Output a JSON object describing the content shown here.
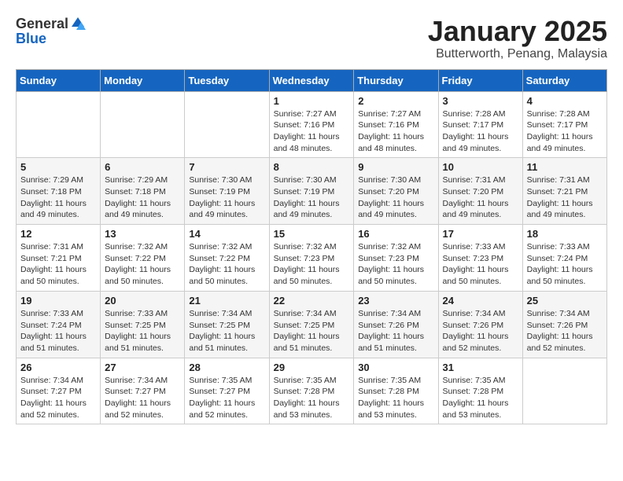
{
  "header": {
    "logo_general": "General",
    "logo_blue": "Blue",
    "month_title": "January 2025",
    "subtitle": "Butterworth, Penang, Malaysia"
  },
  "weekdays": [
    "Sunday",
    "Monday",
    "Tuesday",
    "Wednesday",
    "Thursday",
    "Friday",
    "Saturday"
  ],
  "weeks": [
    [
      {
        "day": "",
        "info": ""
      },
      {
        "day": "",
        "info": ""
      },
      {
        "day": "",
        "info": ""
      },
      {
        "day": "1",
        "info": "Sunrise: 7:27 AM\nSunset: 7:16 PM\nDaylight: 11 hours and 48 minutes."
      },
      {
        "day": "2",
        "info": "Sunrise: 7:27 AM\nSunset: 7:16 PM\nDaylight: 11 hours and 48 minutes."
      },
      {
        "day": "3",
        "info": "Sunrise: 7:28 AM\nSunset: 7:17 PM\nDaylight: 11 hours and 49 minutes."
      },
      {
        "day": "4",
        "info": "Sunrise: 7:28 AM\nSunset: 7:17 PM\nDaylight: 11 hours and 49 minutes."
      }
    ],
    [
      {
        "day": "5",
        "info": "Sunrise: 7:29 AM\nSunset: 7:18 PM\nDaylight: 11 hours and 49 minutes."
      },
      {
        "day": "6",
        "info": "Sunrise: 7:29 AM\nSunset: 7:18 PM\nDaylight: 11 hours and 49 minutes."
      },
      {
        "day": "7",
        "info": "Sunrise: 7:30 AM\nSunset: 7:19 PM\nDaylight: 11 hours and 49 minutes."
      },
      {
        "day": "8",
        "info": "Sunrise: 7:30 AM\nSunset: 7:19 PM\nDaylight: 11 hours and 49 minutes."
      },
      {
        "day": "9",
        "info": "Sunrise: 7:30 AM\nSunset: 7:20 PM\nDaylight: 11 hours and 49 minutes."
      },
      {
        "day": "10",
        "info": "Sunrise: 7:31 AM\nSunset: 7:20 PM\nDaylight: 11 hours and 49 minutes."
      },
      {
        "day": "11",
        "info": "Sunrise: 7:31 AM\nSunset: 7:21 PM\nDaylight: 11 hours and 49 minutes."
      }
    ],
    [
      {
        "day": "12",
        "info": "Sunrise: 7:31 AM\nSunset: 7:21 PM\nDaylight: 11 hours and 50 minutes."
      },
      {
        "day": "13",
        "info": "Sunrise: 7:32 AM\nSunset: 7:22 PM\nDaylight: 11 hours and 50 minutes."
      },
      {
        "day": "14",
        "info": "Sunrise: 7:32 AM\nSunset: 7:22 PM\nDaylight: 11 hours and 50 minutes."
      },
      {
        "day": "15",
        "info": "Sunrise: 7:32 AM\nSunset: 7:23 PM\nDaylight: 11 hours and 50 minutes."
      },
      {
        "day": "16",
        "info": "Sunrise: 7:32 AM\nSunset: 7:23 PM\nDaylight: 11 hours and 50 minutes."
      },
      {
        "day": "17",
        "info": "Sunrise: 7:33 AM\nSunset: 7:23 PM\nDaylight: 11 hours and 50 minutes."
      },
      {
        "day": "18",
        "info": "Sunrise: 7:33 AM\nSunset: 7:24 PM\nDaylight: 11 hours and 50 minutes."
      }
    ],
    [
      {
        "day": "19",
        "info": "Sunrise: 7:33 AM\nSunset: 7:24 PM\nDaylight: 11 hours and 51 minutes."
      },
      {
        "day": "20",
        "info": "Sunrise: 7:33 AM\nSunset: 7:25 PM\nDaylight: 11 hours and 51 minutes."
      },
      {
        "day": "21",
        "info": "Sunrise: 7:34 AM\nSunset: 7:25 PM\nDaylight: 11 hours and 51 minutes."
      },
      {
        "day": "22",
        "info": "Sunrise: 7:34 AM\nSunset: 7:25 PM\nDaylight: 11 hours and 51 minutes."
      },
      {
        "day": "23",
        "info": "Sunrise: 7:34 AM\nSunset: 7:26 PM\nDaylight: 11 hours and 51 minutes."
      },
      {
        "day": "24",
        "info": "Sunrise: 7:34 AM\nSunset: 7:26 PM\nDaylight: 11 hours and 52 minutes."
      },
      {
        "day": "25",
        "info": "Sunrise: 7:34 AM\nSunset: 7:26 PM\nDaylight: 11 hours and 52 minutes."
      }
    ],
    [
      {
        "day": "26",
        "info": "Sunrise: 7:34 AM\nSunset: 7:27 PM\nDaylight: 11 hours and 52 minutes."
      },
      {
        "day": "27",
        "info": "Sunrise: 7:34 AM\nSunset: 7:27 PM\nDaylight: 11 hours and 52 minutes."
      },
      {
        "day": "28",
        "info": "Sunrise: 7:35 AM\nSunset: 7:27 PM\nDaylight: 11 hours and 52 minutes."
      },
      {
        "day": "29",
        "info": "Sunrise: 7:35 AM\nSunset: 7:28 PM\nDaylight: 11 hours and 53 minutes."
      },
      {
        "day": "30",
        "info": "Sunrise: 7:35 AM\nSunset: 7:28 PM\nDaylight: 11 hours and 53 minutes."
      },
      {
        "day": "31",
        "info": "Sunrise: 7:35 AM\nSunset: 7:28 PM\nDaylight: 11 hours and 53 minutes."
      },
      {
        "day": "",
        "info": ""
      }
    ]
  ]
}
